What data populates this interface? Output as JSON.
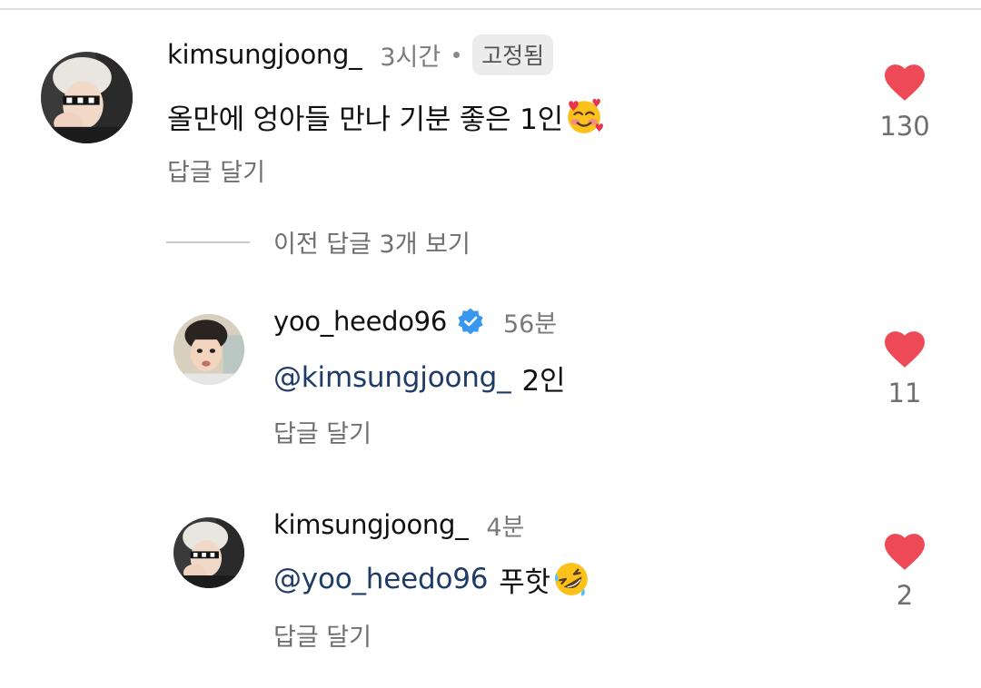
{
  "comments": [
    {
      "username": "kimsungjoong_",
      "time": "3시간",
      "pinned_label": "고정됨",
      "text": "올만에 엉아들 만나 기분 좋은 1인",
      "emoji": "smiling-face-with-hearts",
      "reply_label": "답글 달기",
      "likes": "130"
    }
  ],
  "view_previous": {
    "label": "이전 답글 3개 보기"
  },
  "replies": [
    {
      "username": "yoo_heedo96",
      "verified": true,
      "time": "56분",
      "mention": "@kimsungjoong_",
      "text": "2인",
      "reply_label": "답글 달기",
      "likes": "11"
    },
    {
      "username": "kimsungjoong_",
      "time": "4분",
      "mention": "@yoo_heedo96",
      "text": "푸핫",
      "emoji": "rolling-on-the-floor-laughing",
      "reply_label": "답글 달기",
      "likes": "2"
    }
  ],
  "colors": {
    "heart": "#ed4956",
    "mention": "#1f3c66",
    "verified": "#3897f0"
  }
}
